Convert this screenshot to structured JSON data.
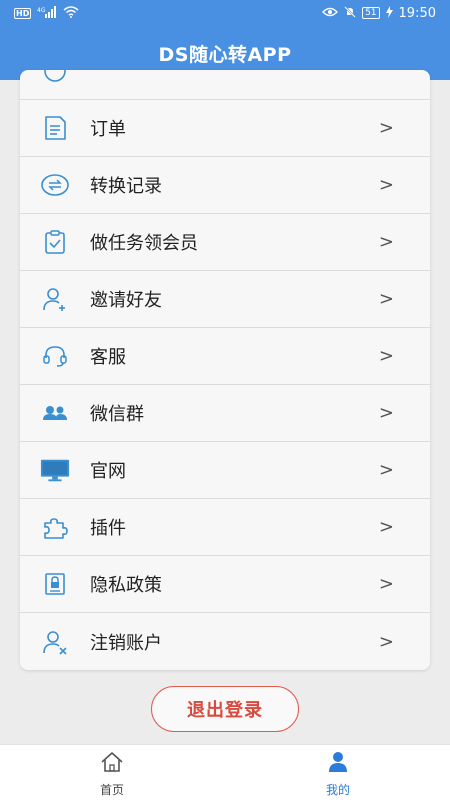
{
  "status_bar": {
    "left": "HD 4G",
    "battery": "51",
    "time": "19:50"
  },
  "header": {
    "title": "DS随心转APP"
  },
  "menu": [
    {
      "label": "订单",
      "icon": "order-icon"
    },
    {
      "label": "转换记录",
      "icon": "convert-record-icon"
    },
    {
      "label": "做任务领会员",
      "icon": "task-icon"
    },
    {
      "label": "邀请好友",
      "icon": "invite-friend-icon"
    },
    {
      "label": "客服",
      "icon": "headset-icon"
    },
    {
      "label": "微信群",
      "icon": "group-icon"
    },
    {
      "label": "官网",
      "icon": "monitor-icon"
    },
    {
      "label": "插件",
      "icon": "puzzle-icon"
    },
    {
      "label": "隐私政策",
      "icon": "privacy-icon"
    },
    {
      "label": "注销账户",
      "icon": "delete-account-icon"
    }
  ],
  "chevron": ">",
  "logout_label": "退出登录",
  "bottom_nav": {
    "home": "首页",
    "mine": "我的"
  },
  "colors": {
    "brand": "#4a90e2",
    "icon": "#3a8fd0",
    "logout": "#d94a3e",
    "active_tab": "#2b7bd9"
  }
}
